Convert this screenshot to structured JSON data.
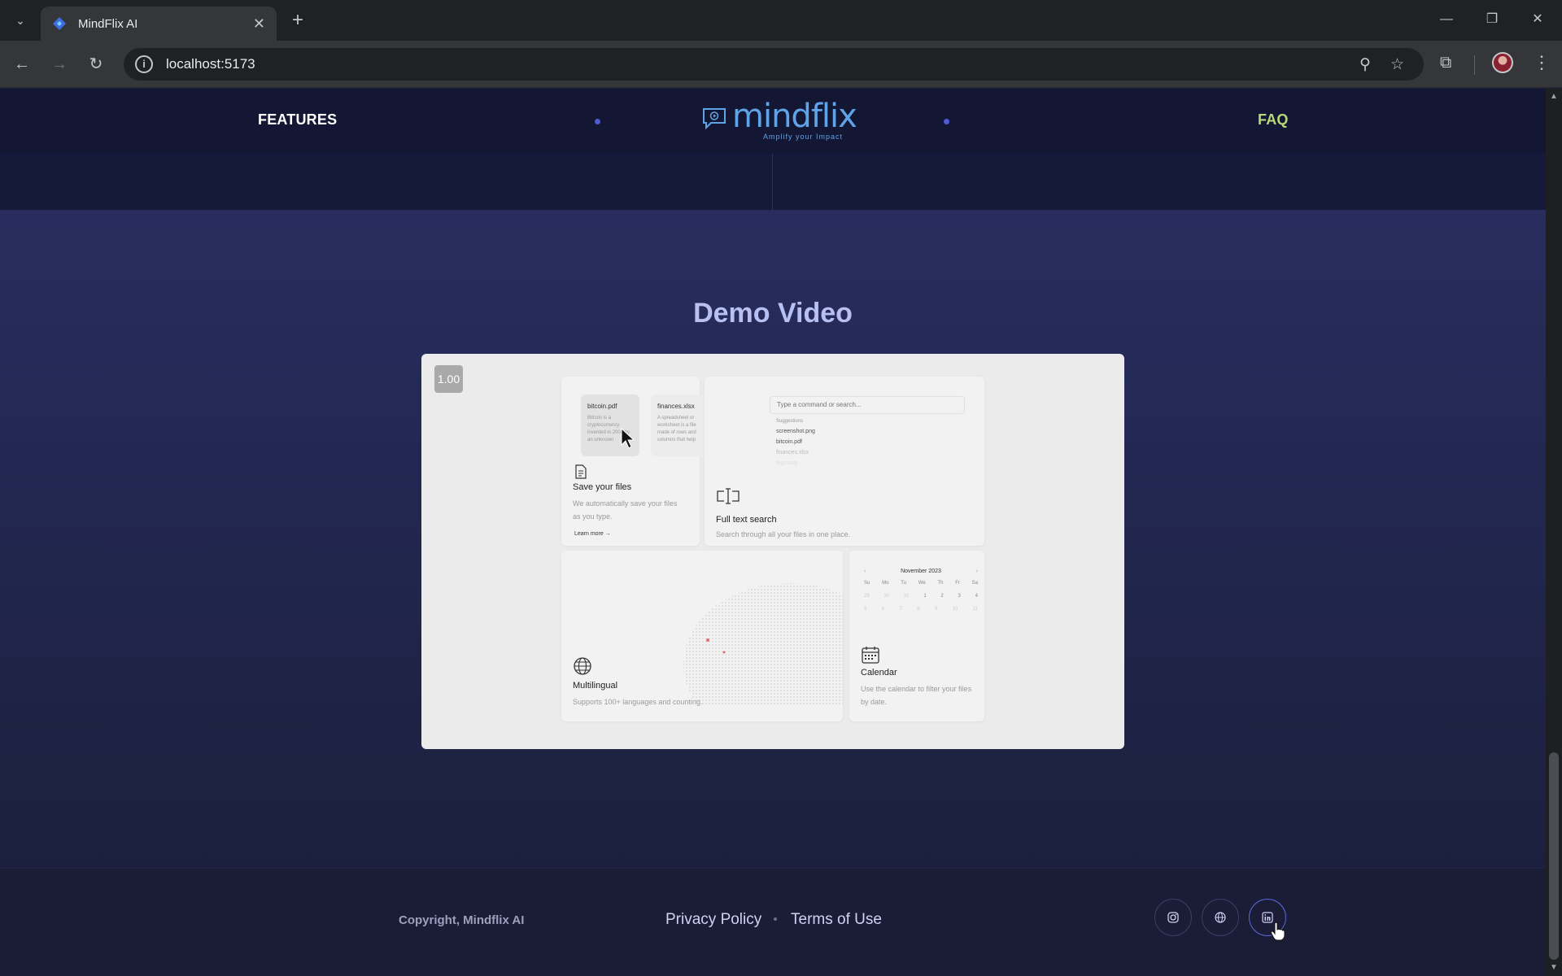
{
  "browser": {
    "tab_title": "MindFlix AI",
    "url": "localhost:5173",
    "icons": {
      "tab_search": "chevron-down-icon",
      "close": "close-icon",
      "new_tab": "plus-icon",
      "back": "arrow-left-icon",
      "forward": "arrow-right-icon",
      "reload": "reload-icon",
      "site_info": "info-icon",
      "zoom": "zoom-icon",
      "bookmark": "star-icon",
      "extensions": "puzzle-icon",
      "menu": "more-vert-icon"
    }
  },
  "site_nav": {
    "left_link": "FEATURES",
    "right_link": "FAQ",
    "logo_word": "mindflix",
    "logo_tagline": "Amplify your Impact",
    "colors": {
      "left": "#ffffff",
      "right": "#b7d97a",
      "dots": "#4f5bd5",
      "logo": "#5fa3e8"
    }
  },
  "demo": {
    "title": "Demo Video",
    "speed": "1.00",
    "cards": {
      "save": {
        "title": "Save your files",
        "desc": "We automatically save your files as you type.",
        "learn_more": "Learn more →",
        "docs": [
          {
            "name": "bitcoin.pdf",
            "text": "Bitcoin is a cryptocurrency invented in 2008 by an unknown"
          },
          {
            "name": "finances.xlsx",
            "text": "A spreadsheet or worksheet is a file made of rows and columns that help"
          }
        ]
      },
      "search": {
        "title": "Full text search",
        "desc": "Search through all your files in one place.",
        "placeholder": "Type a command or search...",
        "suggestions_label": "Suggestions",
        "items": [
          "screenshot.png",
          "bitcoin.pdf",
          "finances.xlsx",
          "logo.svg"
        ]
      },
      "multi": {
        "title": "Multilingual",
        "desc": "Supports 100+ languages and counting."
      },
      "calendar": {
        "title": "Calendar",
        "desc": "Use the calendar to filter your files by date.",
        "month": "November 2023",
        "days": [
          "Su",
          "Mo",
          "Tu",
          "We",
          "Th",
          "Fr",
          "Sa"
        ],
        "week1": [
          "29",
          "30",
          "31",
          "1",
          "2",
          "3",
          "4"
        ],
        "week2": [
          "5",
          "6",
          "7",
          "8",
          "9",
          "10",
          "11"
        ]
      }
    }
  },
  "footer": {
    "copyright": "Copyright, Mindflix AI",
    "privacy": "Privacy Policy",
    "terms": "Terms of Use",
    "social_icons": [
      "instagram-icon",
      "globe-icon",
      "linkedin-icon"
    ]
  }
}
